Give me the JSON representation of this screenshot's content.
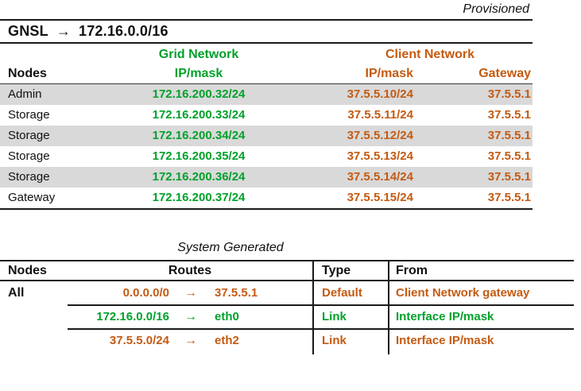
{
  "colors": {
    "green": "#00a12b",
    "orange": "#c55a11",
    "row_shade": "#d9d9d9",
    "line": "#1a1a1a"
  },
  "provisioned_label": "Provisioned",
  "gnsl": {
    "label": "GNSL",
    "arrow": "→",
    "value": "172.16.0.0/16"
  },
  "provisioned_table": {
    "group_headers": {
      "grid": "Grid Network",
      "client": "Client Network"
    },
    "col_headers": {
      "nodes": "Nodes",
      "grid_ip": "IP/mask",
      "client_ip": "IP/mask",
      "gateway": "Gateway"
    },
    "rows": [
      {
        "node": "Admin",
        "grid_ip": "172.16.200.32/24",
        "client_ip": "37.5.5.10/24",
        "gateway": "37.5.5.1"
      },
      {
        "node": "Storage",
        "grid_ip": "172.16.200.33/24",
        "client_ip": "37.5.5.11/24",
        "gateway": "37.5.5.1"
      },
      {
        "node": "Storage",
        "grid_ip": "172.16.200.34/24",
        "client_ip": "37.5.5.12/24",
        "gateway": "37.5.5.1"
      },
      {
        "node": "Storage",
        "grid_ip": "172.16.200.35/24",
        "client_ip": "37.5.5.13/24",
        "gateway": "37.5.5.1"
      },
      {
        "node": "Storage",
        "grid_ip": "172.16.200.36/24",
        "client_ip": "37.5.5.14/24",
        "gateway": "37.5.5.1"
      },
      {
        "node": "Gateway",
        "grid_ip": "172.16.200.37/24",
        "client_ip": "37.5.5.15/24",
        "gateway": "37.5.5.1"
      }
    ]
  },
  "system_generated_label": "System Generated",
  "system_table": {
    "headers": {
      "nodes": "Nodes",
      "routes": "Routes",
      "type": "Type",
      "from": "From"
    },
    "node_label": "All",
    "rows": [
      {
        "destination": "0.0.0.0/0",
        "arrow": "→",
        "target": "37.5.5.1",
        "type": "Default",
        "from": "Client Network gateway",
        "color": "orange"
      },
      {
        "destination": "172.16.0.0/16",
        "arrow": "→",
        "target": "eth0",
        "type": "Link",
        "from": "Interface IP/mask",
        "color": "green"
      },
      {
        "destination": "37.5.5.0/24",
        "arrow": "→",
        "target": "eth2",
        "type": "Link",
        "from": "Interface IP/mask",
        "color": "orange"
      }
    ]
  }
}
